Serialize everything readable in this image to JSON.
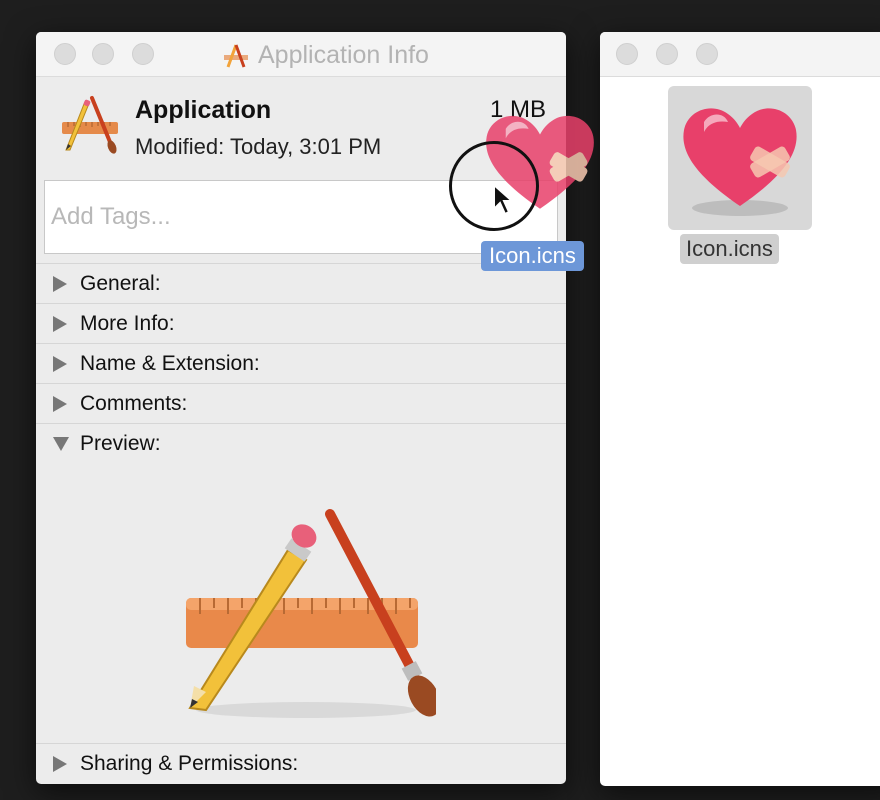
{
  "info_window": {
    "title": "Application Info",
    "app_name": "Application",
    "size": "1 MB",
    "modified_label": "Modified:",
    "modified_value": "Today, 3:01 PM",
    "tags_placeholder": "Add Tags...",
    "sections": [
      {
        "label": "General:",
        "expanded": false
      },
      {
        "label": "More Info:",
        "expanded": false
      },
      {
        "label": "Name & Extension:",
        "expanded": false
      },
      {
        "label": "Comments:",
        "expanded": false
      },
      {
        "label": "Preview:",
        "expanded": true
      },
      {
        "label": "Sharing & Permissions:",
        "expanded": false
      }
    ]
  },
  "finder_window": {
    "file_name": "Icon.icns"
  },
  "drag": {
    "file_name": "Icon.icns"
  },
  "colors": {
    "heart": "#e8406a",
    "ruler": "#e58a4a",
    "pencil": "#f2c13a",
    "brush": "#c8401e",
    "selection_blue": "#6d97d8"
  },
  "icons": [
    "app-store-icon",
    "heart-icon",
    "pointer-cursor-icon"
  ]
}
